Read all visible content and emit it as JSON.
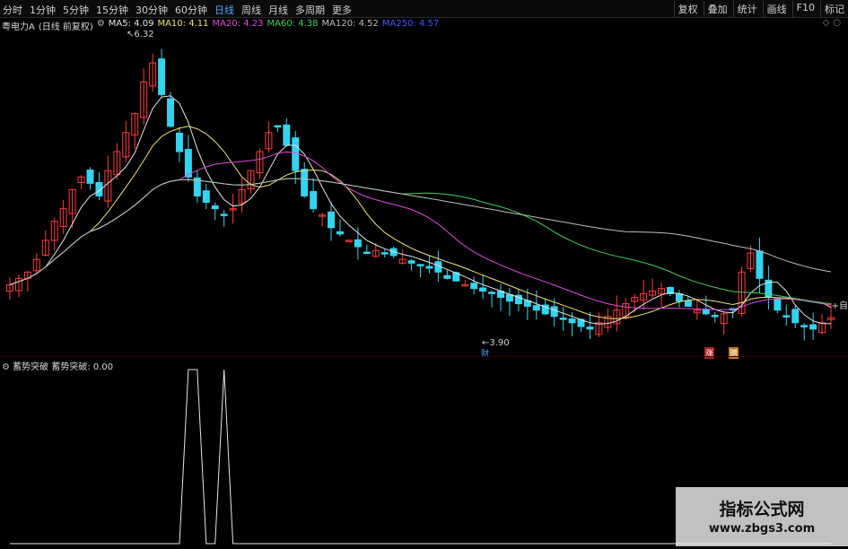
{
  "toolbar": {
    "tabs": [
      "分时",
      "1分钟",
      "5分钟",
      "15分钟",
      "30分钟",
      "60分钟",
      "日线",
      "周线",
      "月线",
      "多周期",
      "更多"
    ],
    "active_tab": "日线",
    "right_buttons": [
      "复权",
      "叠加",
      "统计",
      "画线",
      "F10",
      "标记"
    ]
  },
  "info": {
    "stock_name": "粤电力A",
    "period_note": "(日线 前复权)",
    "ma5": "MA5: 4.09",
    "ma10": "MA10: 4.11",
    "ma20": "MA20: 4.23",
    "ma60": "MA60: 4.38",
    "ma120": "MA120: 4.52",
    "ma250": "MA250: 4.57"
  },
  "colors": {
    "up": "#ff3b3b",
    "down": "#34d4f0",
    "ma5": "#e6e6e6",
    "ma10": "#f2e36b",
    "ma20": "#e04adf",
    "ma60": "#3fd25a",
    "ma120": "#bdbdbd",
    "ma250": "#3b5bff"
  },
  "annotations": {
    "high_label": "6.32",
    "low_label": "3.90",
    "marker_cai": "财",
    "marker_zhang": "涨",
    "marker_zeng": "赠",
    "self_button": "+自"
  },
  "indicator": {
    "title": "蓄势突破",
    "value_text": "蓄势突破: 0.00"
  },
  "watermark": {
    "title": "指标公式网",
    "url": "www.zbgs3.com"
  },
  "chart_data": {
    "type": "candlestick",
    "price_range": [
      3.9,
      6.32
    ],
    "close_series": [
      4.35,
      4.4,
      4.45,
      4.55,
      4.7,
      4.85,
      4.95,
      5.1,
      5.2,
      5.15,
      5.05,
      5.25,
      5.4,
      5.55,
      5.7,
      5.95,
      6.1,
      5.85,
      5.6,
      5.4,
      5.2,
      5.05,
      5.0,
      4.95,
      4.9,
      4.95,
      5.1,
      5.25,
      5.4,
      5.55,
      5.6,
      5.45,
      5.25,
      5.05,
      4.95,
      4.9,
      4.8,
      4.75,
      4.7,
      4.65,
      4.6,
      4.62,
      4.6,
      4.58,
      4.55,
      4.52,
      4.5,
      4.48,
      4.45,
      4.4,
      4.38,
      4.35,
      4.32,
      4.3,
      4.28,
      4.25,
      4.22,
      4.2,
      4.18,
      4.15,
      4.12,
      4.1,
      4.08,
      4.05,
      4.02,
      4.0,
      4.05,
      4.1,
      4.15,
      4.2,
      4.25,
      4.28,
      4.3,
      4.32,
      4.28,
      4.22,
      4.18,
      4.15,
      4.12,
      4.1,
      4.12,
      4.15,
      4.45,
      4.6,
      4.4,
      4.25,
      4.15,
      4.1,
      4.05,
      4.02,
      4.0,
      4.05,
      4.09
    ],
    "indicator_signals": [
      0,
      0,
      0,
      0,
      0,
      0,
      0,
      0,
      0,
      0,
      0,
      0,
      0,
      0,
      0,
      0,
      0,
      0,
      0,
      0,
      1,
      1,
      0,
      0,
      1,
      0,
      0,
      0,
      0,
      0,
      0,
      0,
      0,
      0,
      0,
      0,
      0,
      0,
      0,
      0,
      0,
      0,
      0,
      0,
      0,
      0,
      0,
      0,
      0,
      0,
      0,
      0,
      0,
      0,
      0,
      0,
      0,
      0,
      0,
      0,
      0,
      0,
      0,
      0,
      0,
      0,
      0,
      0,
      0,
      0,
      0,
      0,
      0,
      0,
      0,
      0,
      0,
      0,
      0,
      0,
      0,
      0,
      0,
      0,
      0,
      0,
      0,
      0,
      0,
      0,
      0,
      0,
      0
    ]
  }
}
